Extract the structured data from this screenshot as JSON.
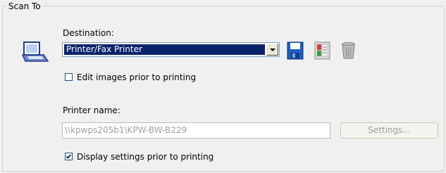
{
  "group": {
    "title": "Scan To"
  },
  "destination": {
    "label": "Destination:",
    "selected": "Printer/Fax Printer"
  },
  "toolbar": {
    "icons": [
      "save-icon",
      "properties-icon",
      "delete-icon"
    ]
  },
  "edit_images": {
    "label": "Edit images prior to printing",
    "checked": false
  },
  "printer": {
    "label": "Printer name:",
    "value": "\\\\kpwps205b1\\KPW-BW-B229",
    "settings_label": "Settings..."
  },
  "display_settings": {
    "label": "Display settings prior to printing",
    "checked": true
  },
  "colors": {
    "selection": "#0a246a",
    "disabled_text": "#a0a0a0",
    "group_border": "#d0d0bf"
  }
}
